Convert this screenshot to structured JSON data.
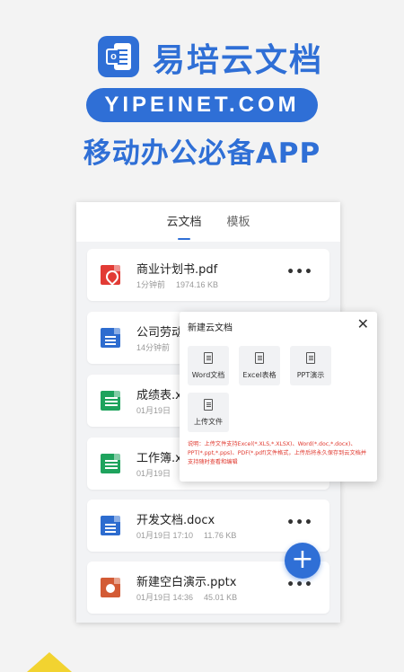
{
  "hero": {
    "logo_letter": "o",
    "title": "易培云文档",
    "domain": "YIPEINET.COM",
    "subtitle": "移动办公必备APP"
  },
  "tabs": [
    {
      "label": "云文档",
      "active": true
    },
    {
      "label": "模板",
      "active": false
    }
  ],
  "files": [
    {
      "name": "商业计划书.pdf",
      "time": "1分钟前",
      "size": "1974.16 KB",
      "icon": "pdf-icon",
      "color": "#e23b35"
    },
    {
      "name": "公司劳动",
      "time": "14分钟前",
      "size": "",
      "icon": "doc-icon",
      "color": "#2d6ccf"
    },
    {
      "name": "成绩表.x",
      "time": "01月19日",
      "size": "",
      "icon": "sheet-icon",
      "color": "#1ea35d"
    },
    {
      "name": "工作簿.x",
      "time": "01月19日",
      "size": "",
      "icon": "sheet-icon",
      "color": "#1ea35d"
    },
    {
      "name": "开发文档.docx",
      "time": "01月19日 17:10",
      "size": "11.76 KB",
      "icon": "doc-icon",
      "color": "#2d6ccf"
    },
    {
      "name": "新建空白演示.pptx",
      "time": "01月19日 14:36",
      "size": "45.01 KB",
      "icon": "slides-icon",
      "color": "#d35b35"
    }
  ],
  "more_label": "•••",
  "fab_label": "+",
  "dialog": {
    "title": "新建云文档",
    "close": "✕",
    "options": [
      {
        "label": "Word文档"
      },
      {
        "label": "Excel表格"
      },
      {
        "label": "PPT演示"
      },
      {
        "label": "上传文件"
      }
    ],
    "note": "说明：上传文件支持Excel(*.XLS,*.XLSX)、Word(*.doc,*.docx)、PPT(*.ppt,*.pps)、PDF(*.pdf)文件格式，上传后将永久保存到云文档并支持随时查看和编辑"
  }
}
